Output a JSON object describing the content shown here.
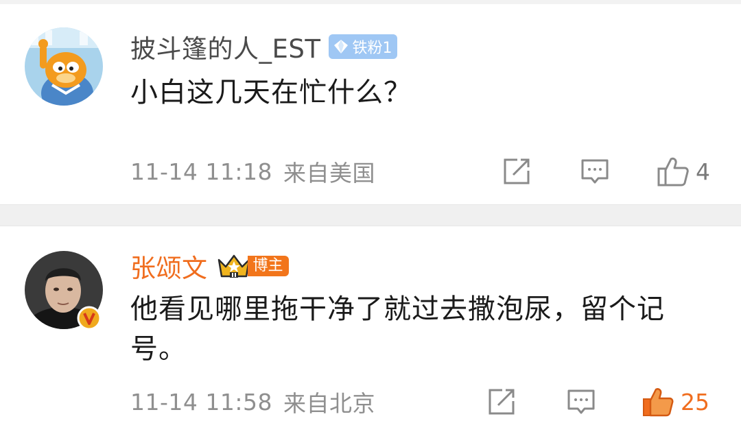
{
  "comments": [
    {
      "username": "披斗篷的人_EST",
      "badge": {
        "type": "fan",
        "label": "铁粉1",
        "color": "#9fc7f4"
      },
      "text": "小白这几天在忙什么？",
      "time": "11-14 11:18",
      "location": "来自美国",
      "likes": "4",
      "liked": false,
      "avatar_icon": "garfield-cartoon"
    },
    {
      "username": "张颂文",
      "badge": {
        "type": "blogger",
        "label": "博主",
        "color": "#f2751b"
      },
      "verified": true,
      "text": "他看见哪里拖干净了就过去撒泡尿，留个记号。",
      "time": "11-14 11:58",
      "location": "来自北京",
      "likes": "25",
      "liked": true,
      "avatar_icon": "portrait-photo"
    }
  ],
  "colors": {
    "accent": "#f06d1e",
    "meta": "#8f8f8f",
    "divider": "#f0f0f0"
  }
}
